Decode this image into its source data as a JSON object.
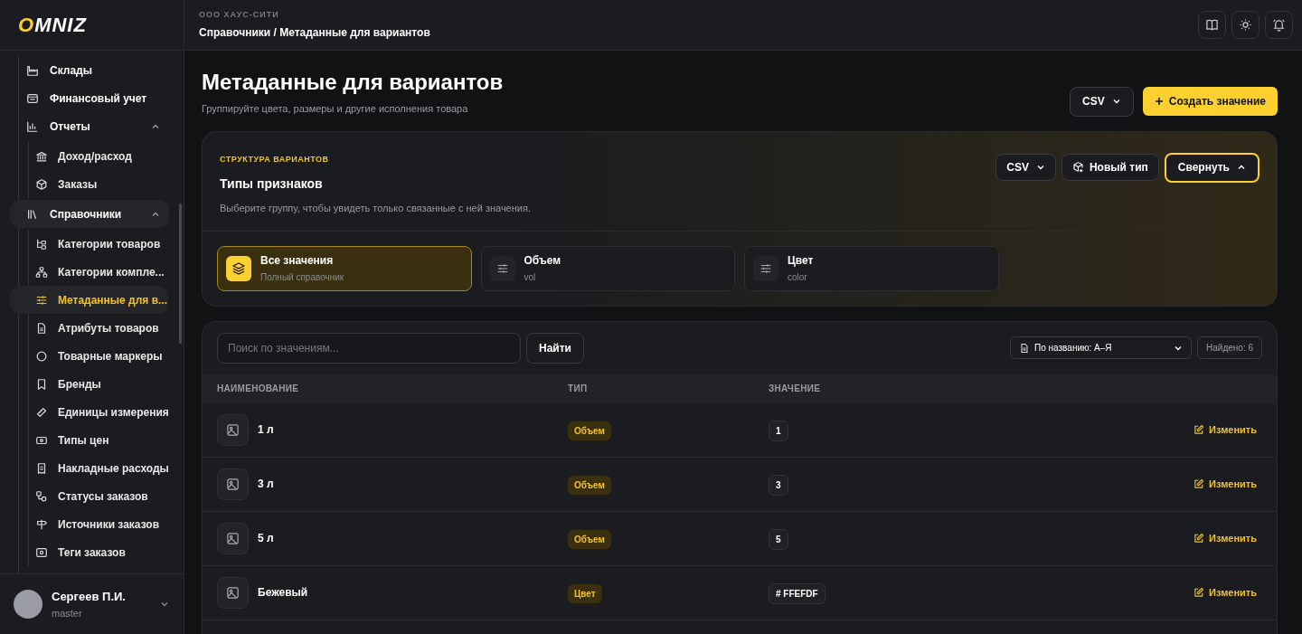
{
  "brand": {
    "logo": "OMNIZ"
  },
  "sidebar": {
    "items": [
      {
        "label": "Склады",
        "selected": false
      },
      {
        "label": "Финансовый учет",
        "selected": false
      },
      {
        "label": "Отчеты",
        "selected": false,
        "expanded": true,
        "children": [
          {
            "label": "Доход/расход",
            "selected": false
          },
          {
            "label": "Заказы",
            "selected": false
          }
        ]
      },
      {
        "label": "Справочники",
        "selected": true,
        "expanded": true,
        "children": [
          {
            "label": "Категории товаров",
            "selected": false
          },
          {
            "label": "Категории компле...",
            "selected": false
          },
          {
            "label": "Метаданные для в...",
            "selected": true
          },
          {
            "label": "Атрибуты товаров",
            "selected": false
          },
          {
            "label": "Товарные маркеры",
            "selected": false
          },
          {
            "label": "Бренды",
            "selected": false
          },
          {
            "label": "Единицы измерения",
            "selected": false
          },
          {
            "label": "Типы цен",
            "selected": false
          },
          {
            "label": "Накладные расходы",
            "selected": false
          },
          {
            "label": "Статусы заказов",
            "selected": false
          },
          {
            "label": "Источники заказов",
            "selected": false
          },
          {
            "label": "Теги заказов",
            "selected": false
          }
        ]
      }
    ]
  },
  "user": {
    "name": "Сергеев П.И.",
    "role": "master"
  },
  "header": {
    "org": "ООО ХАУС-СИТИ",
    "breadcrumb": "Справочники / Метаданные для вариантов"
  },
  "page": {
    "title": "Метаданные для вариантов",
    "subtitle": "Группируйте цвета, размеры и другие исполнения товара",
    "export_button": "CSV",
    "create_button": "Создать значение"
  },
  "structure": {
    "eyebrow": "СТРУКТУРА ВАРИАНТОВ",
    "title": "Типы признаков",
    "description": "Выберите группу, чтобы увидеть только связанные с ней значения.",
    "export_button": "CSV",
    "new_type_button": "Новый тип",
    "collapse_button": "Свернуть",
    "types": [
      {
        "title": "Все значения",
        "subtitle": "Полный справочник",
        "selected": true
      },
      {
        "title": "Объем",
        "subtitle": "vol",
        "selected": false
      },
      {
        "title": "Цвет",
        "subtitle": "color",
        "selected": false
      }
    ]
  },
  "values": {
    "search": {
      "placeholder": "Поиск по значениям..."
    },
    "search_button": "Найти",
    "sort": "По названию: А–Я",
    "count": "Найдено: 6",
    "columns": [
      "НАИМЕНОВАНИЕ",
      "ТИП",
      "ЗНАЧЕНИЕ"
    ],
    "rows": [
      {
        "name": "1 л",
        "type": "Объем",
        "value": "1",
        "action": "Изменить"
      },
      {
        "name": "3 л",
        "type": "Объем",
        "value": "3",
        "action": "Изменить"
      },
      {
        "name": "5 л",
        "type": "Объем",
        "value": "5",
        "action": "Изменить"
      },
      {
        "name": "Бежевый",
        "type": "Цвет",
        "value": "# FFEFDF",
        "action": "Изменить"
      }
    ]
  }
}
